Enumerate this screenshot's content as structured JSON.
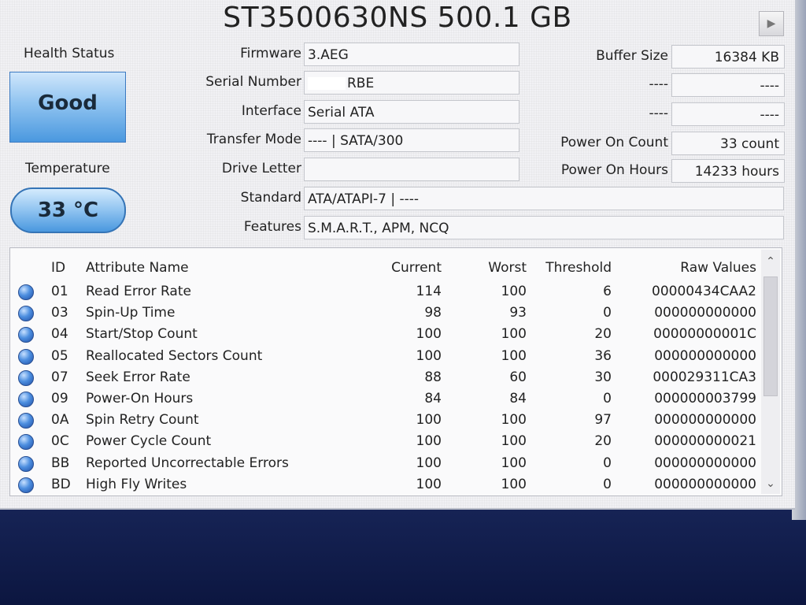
{
  "title": "ST3500630NS 500.1 GB",
  "nav_button_icon": "play-arrow-icon",
  "health": {
    "label": "Health Status",
    "value": "Good"
  },
  "temperature": {
    "label": "Temperature",
    "value": "33 °C"
  },
  "info": {
    "firmware": {
      "label": "Firmware",
      "value": "3.AEG"
    },
    "serial": {
      "label": "Serial Number",
      "value": "RBE"
    },
    "interface": {
      "label": "Interface",
      "value": "Serial ATA"
    },
    "transfer_mode": {
      "label": "Transfer Mode",
      "value": "---- | SATA/300"
    },
    "drive_letter": {
      "label": "Drive Letter",
      "value": ""
    },
    "standard": {
      "label": "Standard",
      "value": "ATA/ATAPI-7 | ----"
    },
    "features": {
      "label": "Features",
      "value": "S.M.A.R.T., APM, NCQ"
    }
  },
  "right_info": {
    "buffer_size": {
      "label": "Buffer Size",
      "value": "16384 KB"
    },
    "blank1": {
      "label": "----",
      "value": "----"
    },
    "blank2": {
      "label": "----",
      "value": "----"
    },
    "power_on_count": {
      "label": "Power On Count",
      "value": "33 count"
    },
    "power_on_hours": {
      "label": "Power On Hours",
      "value": "14233 hours"
    }
  },
  "table": {
    "headers": {
      "id": "ID",
      "name": "Attribute Name",
      "current": "Current",
      "worst": "Worst",
      "threshold": "Threshold",
      "raw": "Raw Values"
    },
    "rows": [
      {
        "id": "01",
        "name": "Read Error Rate",
        "current": "114",
        "worst": "100",
        "threshold": "6",
        "raw": "00000434CAA2"
      },
      {
        "id": "03",
        "name": "Spin-Up Time",
        "current": "98",
        "worst": "93",
        "threshold": "0",
        "raw": "000000000000"
      },
      {
        "id": "04",
        "name": "Start/Stop Count",
        "current": "100",
        "worst": "100",
        "threshold": "20",
        "raw": "00000000001C"
      },
      {
        "id": "05",
        "name": "Reallocated Sectors Count",
        "current": "100",
        "worst": "100",
        "threshold": "36",
        "raw": "000000000000"
      },
      {
        "id": "07",
        "name": "Seek Error Rate",
        "current": "88",
        "worst": "60",
        "threshold": "30",
        "raw": "000029311CA3"
      },
      {
        "id": "09",
        "name": "Power-On Hours",
        "current": "84",
        "worst": "84",
        "threshold": "0",
        "raw": "000000003799"
      },
      {
        "id": "0A",
        "name": "Spin Retry Count",
        "current": "100",
        "worst": "100",
        "threshold": "97",
        "raw": "000000000000"
      },
      {
        "id": "0C",
        "name": "Power Cycle Count",
        "current": "100",
        "worst": "100",
        "threshold": "20",
        "raw": "000000000021"
      },
      {
        "id": "BB",
        "name": "Reported Uncorrectable Errors",
        "current": "100",
        "worst": "100",
        "threshold": "0",
        "raw": "000000000000"
      },
      {
        "id": "BD",
        "name": "High Fly Writes",
        "current": "100",
        "worst": "100",
        "threshold": "0",
        "raw": "000000000000"
      }
    ]
  },
  "colors": {
    "health_good": "#4a98df",
    "status_dot": "#4d8fe0",
    "desktop": "#2c3f7c"
  }
}
